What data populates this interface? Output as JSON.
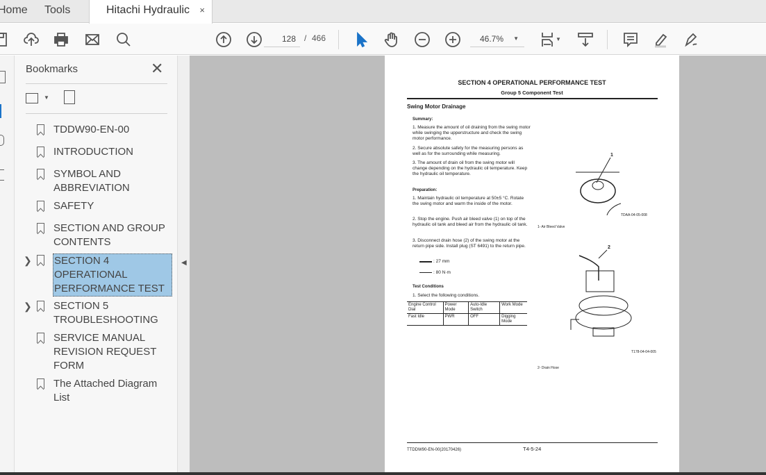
{
  "tabs": {
    "home": "Home",
    "tools": "Tools",
    "document": "Hitachi Hydraulic Ex...",
    "close": "×"
  },
  "toolbar": {
    "page_current": "128",
    "page_sep": "/",
    "page_total": "466",
    "zoom": "46.7%"
  },
  "bookmarks": {
    "title": "Bookmarks",
    "close": "✕",
    "items": [
      {
        "label": "TDDW90-EN-00",
        "expandable": false
      },
      {
        "label": "INTRODUCTION",
        "expandable": false
      },
      {
        "label": "SYMBOL AND ABBREVIATION",
        "expandable": false
      },
      {
        "label": "SAFETY",
        "expandable": false
      },
      {
        "label": "SECTION AND GROUP CONTENTS",
        "expandable": false
      },
      {
        "label": "SECTION 4 OPERATIONAL PERFORMANCE TEST",
        "expandable": true,
        "selected": true
      },
      {
        "label": "SECTION 5 TROUBLESHOOTING",
        "expandable": true
      },
      {
        "label": "SERVICE MANUAL REVISION REQUEST FORM",
        "expandable": false
      },
      {
        "label": "The Attached Diagram List",
        "expandable": false
      }
    ]
  },
  "doc": {
    "section": "SECTION 4 OPERATIONAL PERFORMANCE TEST",
    "group": "Group 5 Component Test",
    "heading": "Swing Motor Drainage",
    "summary_title": "Summary:",
    "summary": [
      "1. Measure the amount of oil draining from the swing motor while swinging the upperstructure and check the swing motor performance.",
      "2. Secure absolute safety for the measuring persons as well as for the surrounding while measuring.",
      "3. The amount of drain oil from the swing motor will change depending on the hydraulic oil temperature. Keep the hydraulic oil temperature."
    ],
    "prep_title": "Preparation:",
    "prep": [
      "1. Maintain hydraulic oil temperature at 50±5 °C. Rotate the swing motor and warm the inside of the motor.",
      "2. Stop the engine. Push air bleed valve (1) on top of the hydraulic oil tank and bleed air from the hydraulic oil tank.",
      "3. Disconnect drain hose (2) of the swing motor at the return pipe side. Install plug (ST 6491) to the return pipe."
    ],
    "wrench": ": 27 mm",
    "torque": ": 80 N·m",
    "test_title": "Test Conditions",
    "test_item": "1. Select the following conditions.",
    "table": {
      "headers": [
        "Engine Control Dial",
        "Power Mode",
        "Auto-Idle Switch",
        "Work Mode"
      ],
      "row": [
        "Fast Idle",
        "PWR",
        "OFF",
        "Digging Mode"
      ]
    },
    "fig1_callout": "1",
    "fig1_code": "TDAA-04-05-008",
    "fig1_caption": "1-    Air Bleed Valve",
    "fig2_callout": "2",
    "fig2_code": "T178-04-04-005",
    "fig2_caption": "2-    Drain Hose",
    "footer_left": "TTDDW90-EN-00(20170426)",
    "footer_page": "T4-5-24"
  }
}
